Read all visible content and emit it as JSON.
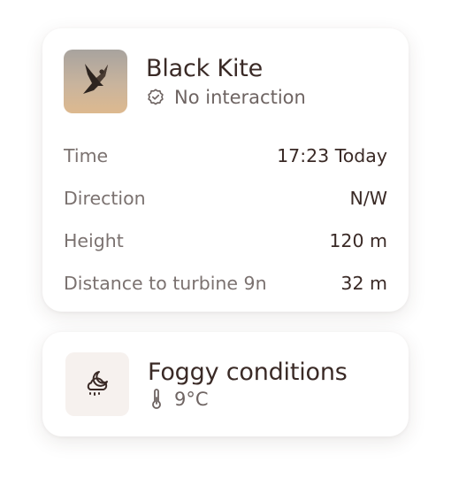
{
  "sighting": {
    "species": "Black Kite",
    "status": "No interaction",
    "status_icon": "check-badge-icon",
    "thumbnail_icon": "kite-photo",
    "details": [
      {
        "label": "Time",
        "value": "17:23 Today"
      },
      {
        "label": "Direction",
        "value": "N/W"
      },
      {
        "label": "Height",
        "value": "120 m"
      },
      {
        "label": "Distance to turbine 9n",
        "value": "32 m"
      }
    ]
  },
  "weather": {
    "condition": "Foggy conditions",
    "temperature": "9°C",
    "condition_icon": "cloud-moon-icon",
    "temperature_icon": "thermometer-icon"
  },
  "colors": {
    "text_primary": "#3a2a26",
    "text_secondary": "#7b7270",
    "icon_box": "#f6f1ee"
  }
}
